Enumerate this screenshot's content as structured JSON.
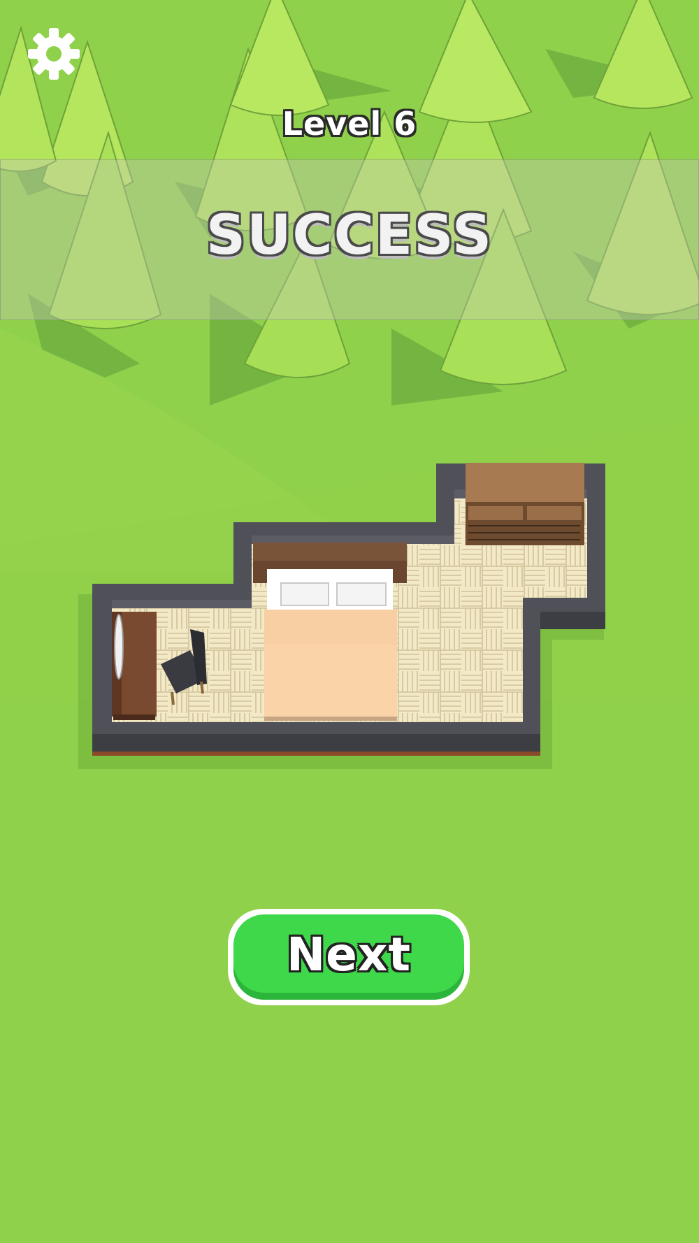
{
  "hud": {
    "settings_icon": "gear-icon",
    "level_label": "Level 6"
  },
  "result": {
    "status_text": "SUCCESS"
  },
  "actions": {
    "next_label": "Next"
  },
  "colors": {
    "grass": "#8fd14a",
    "tree": "#a8e05a",
    "wall": "#4f5058",
    "floor": "#f3e8c4",
    "bed_sheet": "#fbd2a6",
    "wood": "#8a5a3a",
    "next_button": "#3fd84a"
  }
}
